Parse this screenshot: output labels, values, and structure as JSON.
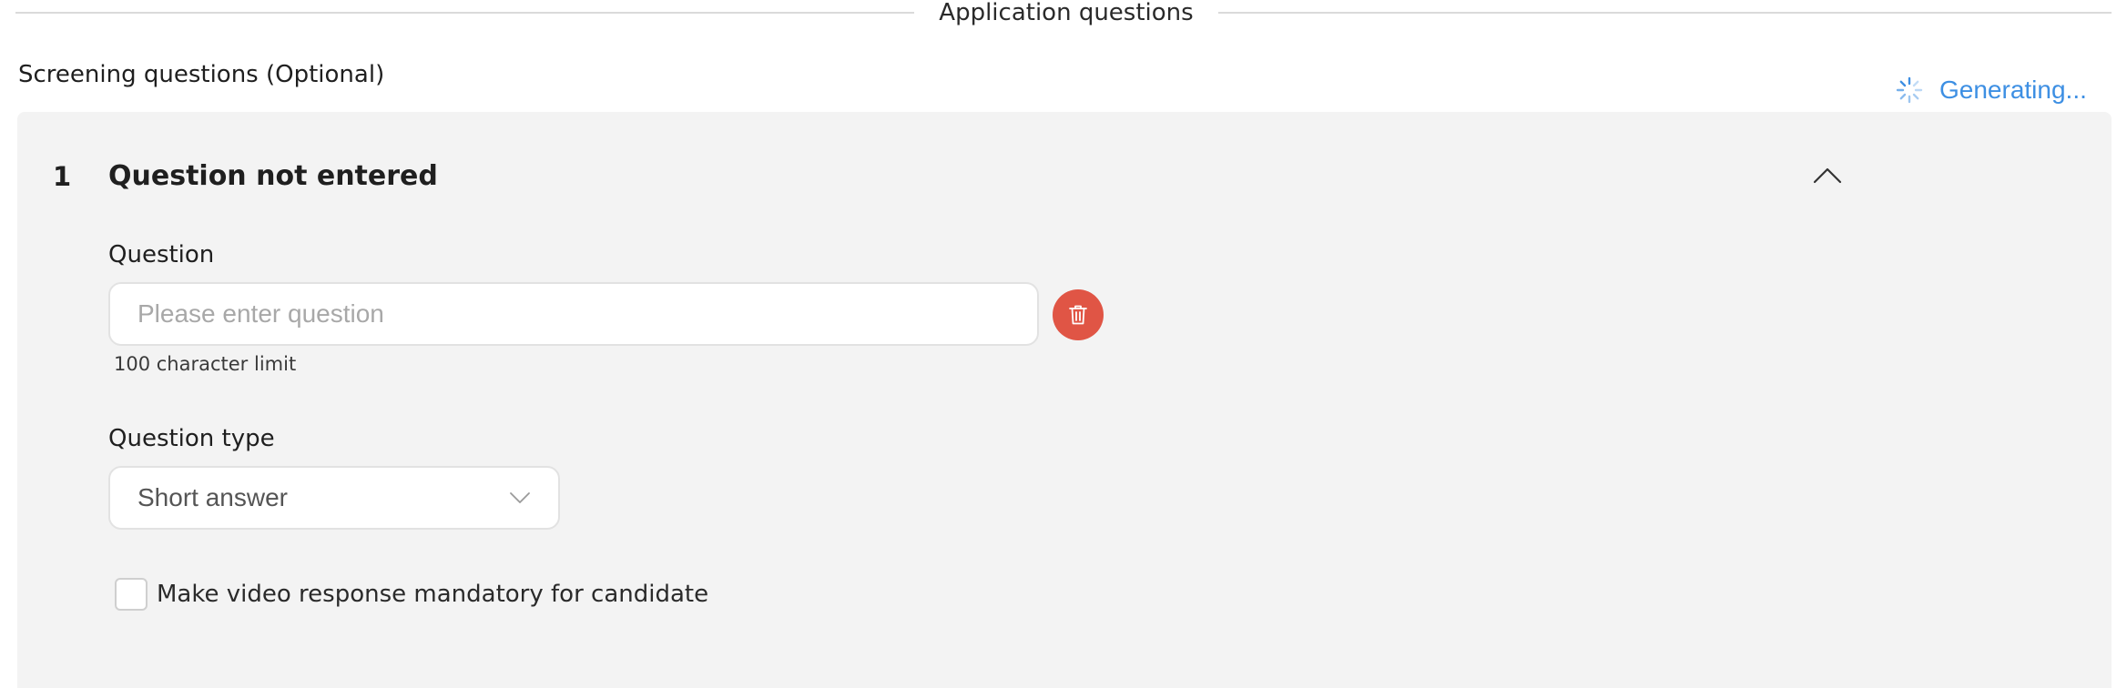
{
  "section": {
    "title": "Application questions"
  },
  "screening": {
    "label": "Screening questions (Optional)",
    "status_text": "Generating...",
    "status_icon": "spinner-icon",
    "status_color": "#3d8fe3"
  },
  "question_card": {
    "number": "1",
    "title": "Question not entered",
    "collapse_icon": "chevron-up-icon",
    "question_field": {
      "label": "Question",
      "value": "",
      "placeholder": "Please enter question",
      "hint": "100 character limit"
    },
    "delete_icon": "trash-icon",
    "delete_color": "#e05545",
    "question_type": {
      "label": "Question type",
      "selected": "Short answer"
    },
    "video_mandatory": {
      "label": "Make video response mandatory for candidate",
      "checked": false
    }
  }
}
